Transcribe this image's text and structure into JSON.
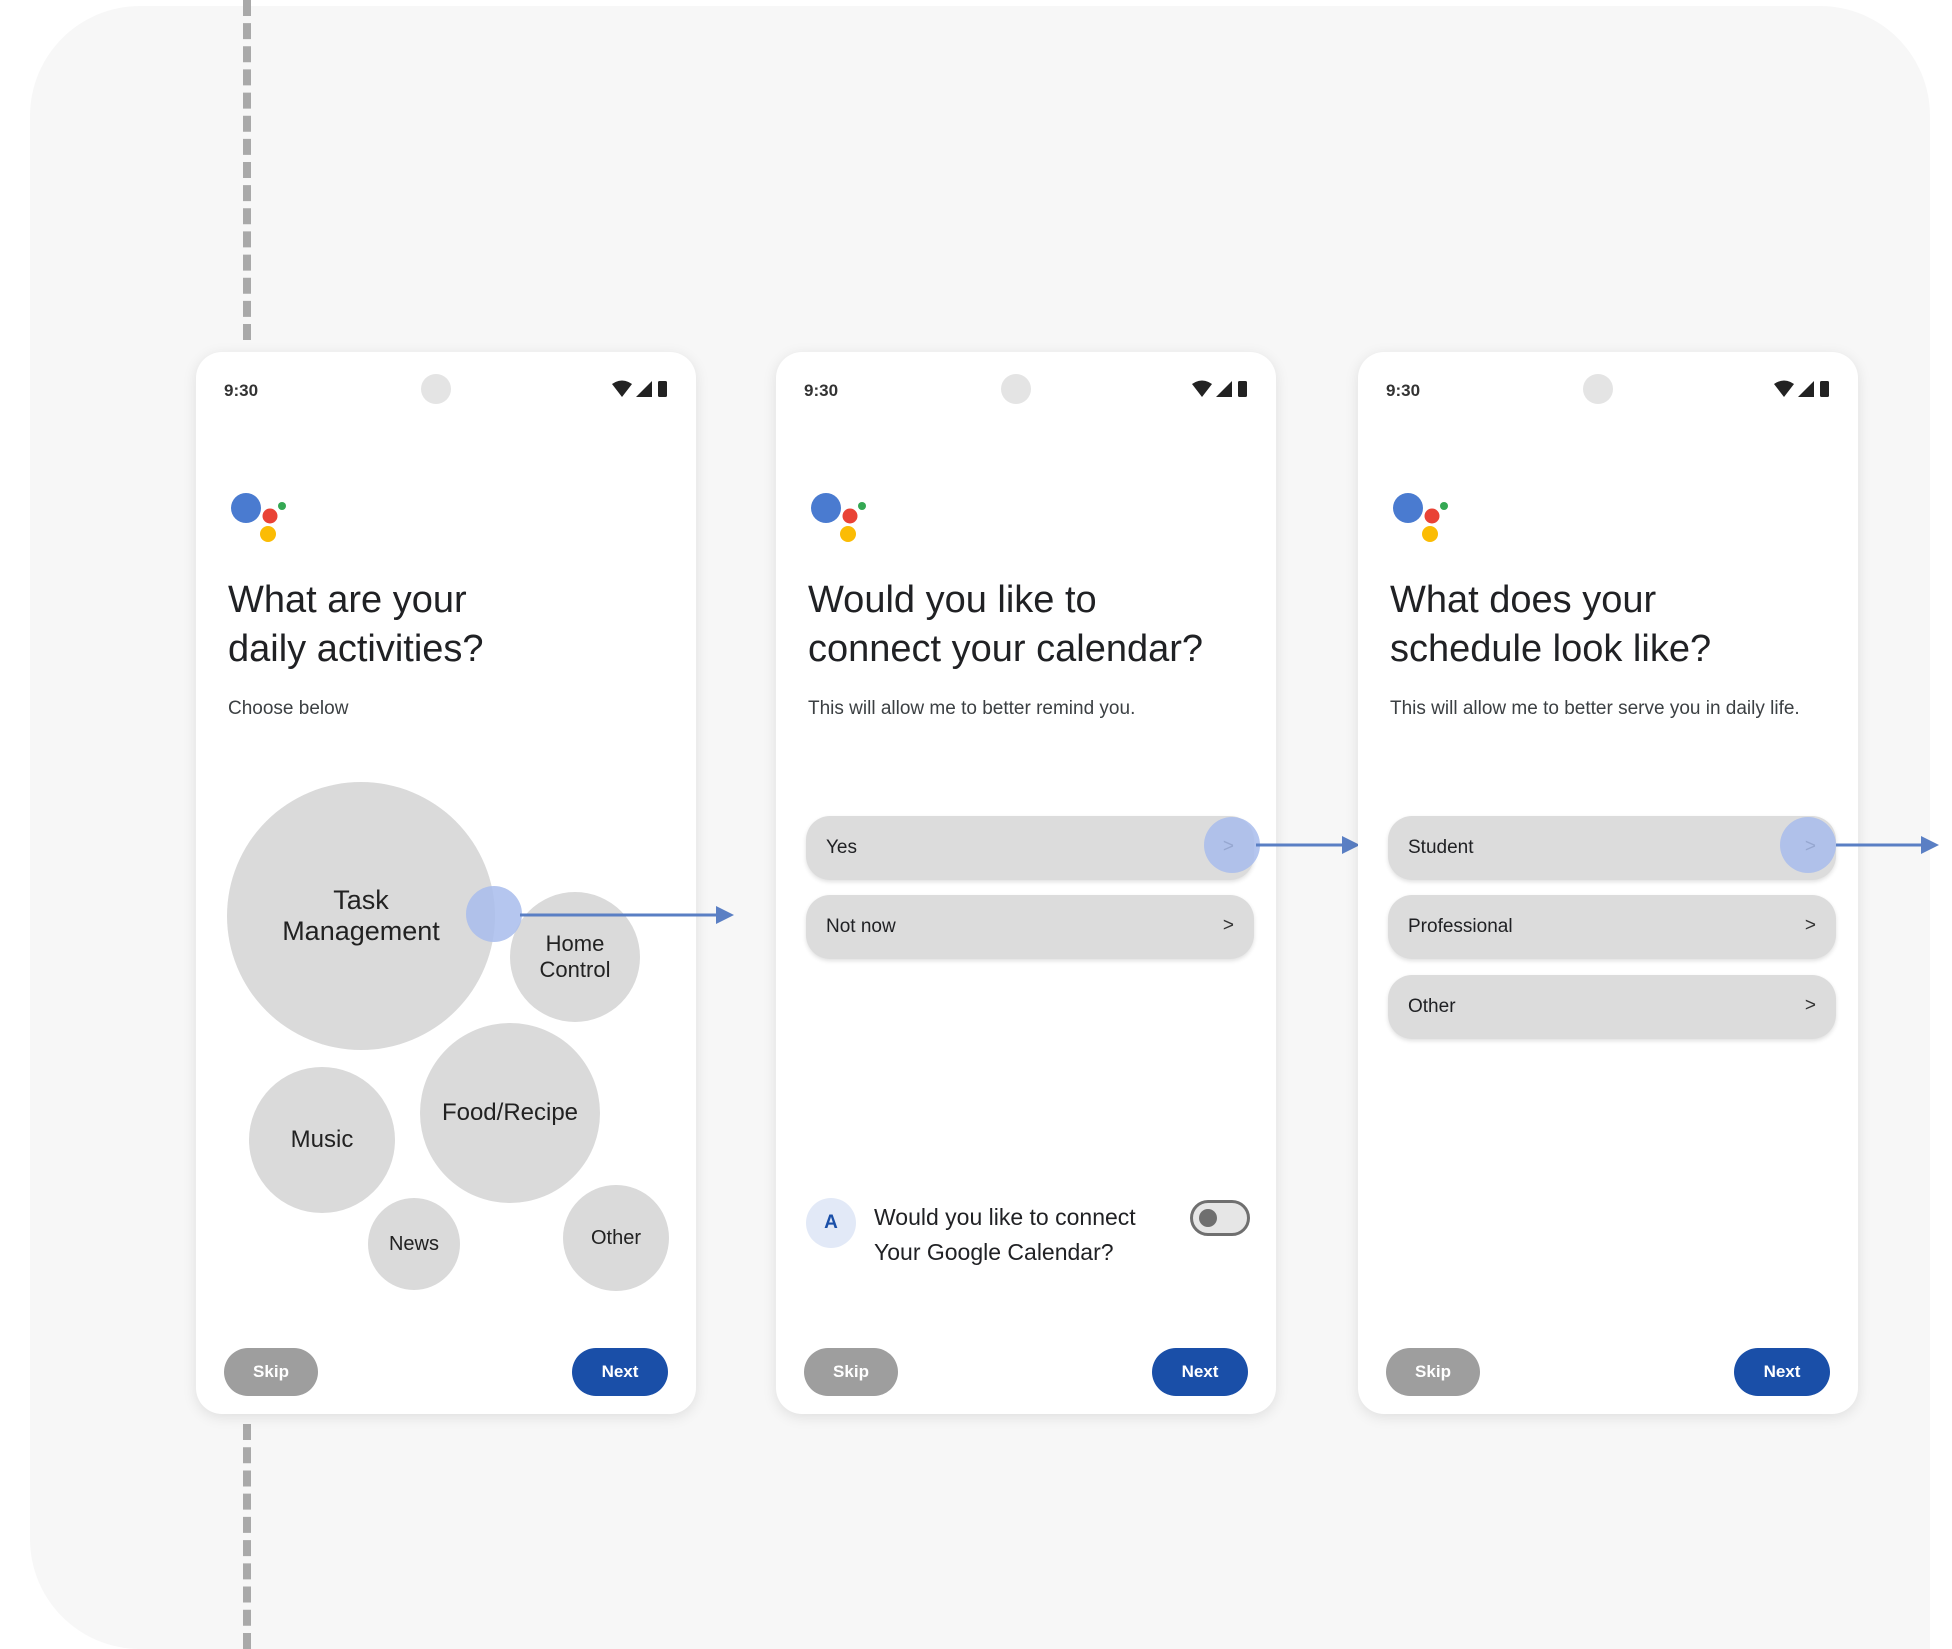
{
  "colors": {
    "accent": "#1a4fa8",
    "touch_indicator": "#a8bcec",
    "flow_arrow": "#5a7fc4",
    "google_blue": "#4a7bd0",
    "google_red": "#e94235",
    "google_yellow": "#fbbc04",
    "google_green": "#34a853"
  },
  "status_bar": {
    "time": "9:30",
    "icons": [
      "wifi-icon",
      "cellular-signal-icon",
      "battery-icon"
    ]
  },
  "screens": [
    {
      "title": "What are your\ndaily activities?",
      "subtitle": "Choose below",
      "bubbles": [
        "Task\nManagement",
        "Home\nControl",
        "Food/Recipe",
        "Music",
        "News",
        "Other"
      ],
      "skip_label": "Skip",
      "next_label": "Next"
    },
    {
      "title": "Would you like to\nconnect your calendar?",
      "subtitle": "This will allow me to better remind you.",
      "options": [
        {
          "label": "Yes",
          "chevron": ">"
        },
        {
          "label": "Not now",
          "chevron": ">"
        }
      ],
      "assistant_avatar": "A",
      "prompt": "Would you like to connect\nYour Google Calendar?",
      "toggle_on": false,
      "skip_label": "Skip",
      "next_label": "Next"
    },
    {
      "title": "What does your\nschedule look like?",
      "subtitle": "This will allow me to better serve you in daily life.",
      "options": [
        {
          "label": "Student",
          "chevron": ">"
        },
        {
          "label": "Professional",
          "chevron": ">"
        },
        {
          "label": "Other",
          "chevron": ">"
        }
      ],
      "skip_label": "Skip",
      "next_label": "Next"
    }
  ]
}
